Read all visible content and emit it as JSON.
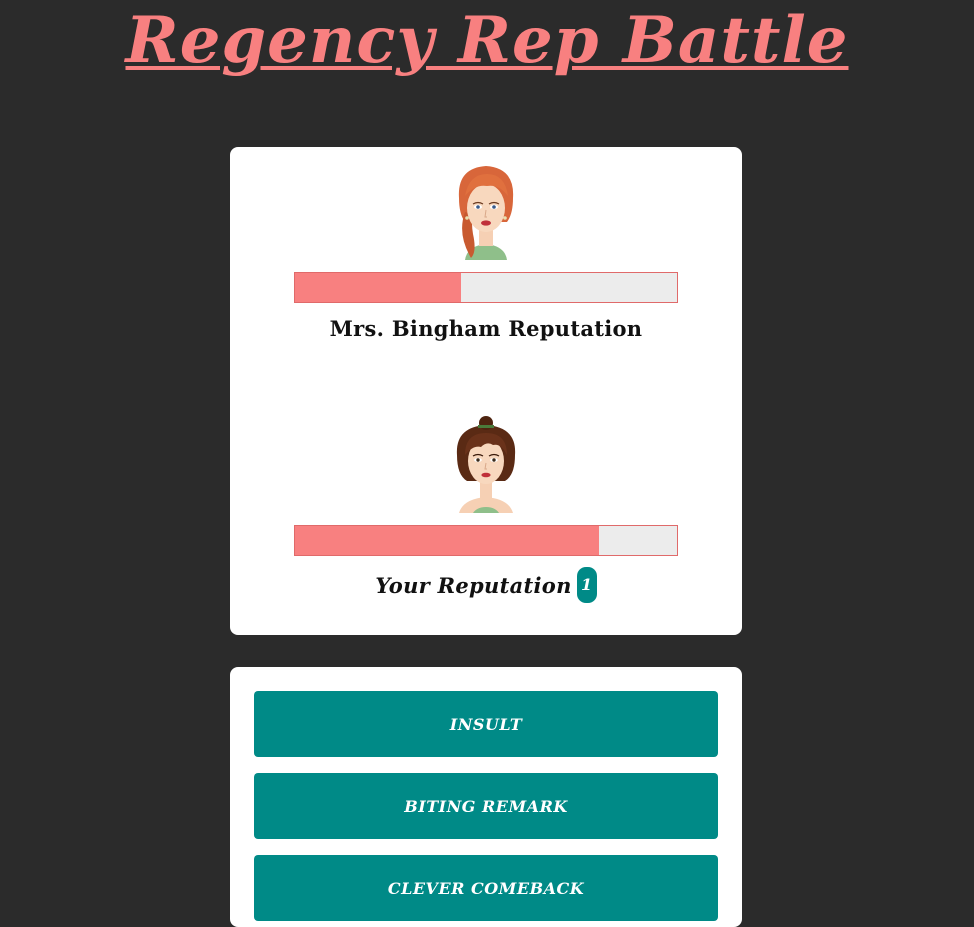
{
  "page": {
    "title": "Regency Rep Battle"
  },
  "opponent": {
    "label": "Mrs. Bingham Reputation",
    "reputation_fraction": 0.435,
    "portrait": "opponent-lady-portrait"
  },
  "player": {
    "label": "Your Reputation",
    "badge": "1",
    "reputation_fraction": 0.795,
    "portrait": "player-lady-portrait"
  },
  "actions": [
    {
      "label": "INSULT"
    },
    {
      "label": "BITING REMARK"
    },
    {
      "label": "CLEVER COMEBACK"
    }
  ],
  "colors": {
    "background": "#2b2b2b",
    "title": "#f88080",
    "bar_fill": "#f88080",
    "bar_track": "#ececec",
    "button": "#008a87",
    "badge": "#008a87"
  }
}
